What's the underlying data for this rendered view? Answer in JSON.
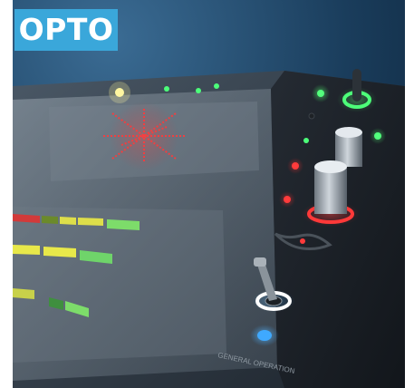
{
  "badge": {
    "label": "OPTO",
    "color": "#3aa7da"
  },
  "panel": {
    "caption": "GENERAL OPERATION"
  },
  "colors": {
    "background": "#14324d",
    "panel_surface": "#262d36",
    "led_red": "#ff3b3b",
    "led_green": "#4cff7a",
    "led_yellow": "#e8e84a",
    "button_blue": "#3fa9ff"
  }
}
